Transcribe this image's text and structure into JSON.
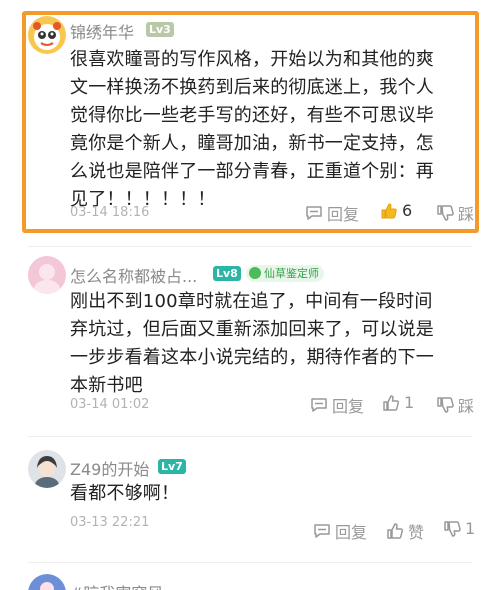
{
  "comments": [
    {
      "name": "锦绣年华",
      "level": "Lv3",
      "text_lines": [
        "很喜欢瞳哥的写作风格，开始以为和其他的爽",
        "文一样换汤不换药到后来的彻底迷上，我个人",
        "觉得你比一些老手写的还好，有些不可思议毕",
        "竟你是个新人，瞳哥加油，新书一定支持，怎",
        "么说也是陪伴了一部分青春，正重道个别：再",
        "见了！！！！！！"
      ],
      "time": "03-14 18:16",
      "reply_label": "回复",
      "like_count": "6",
      "dislike_label": "踩",
      "highlighted": true,
      "liked": true
    },
    {
      "name": "怎么名称都被占...",
      "level": "Lv8",
      "badge": "仙草鉴定师",
      "text_lines": [
        "刚出不到100章时就在追了，中间有一段时间",
        "弃坑过，但后面又重新添加回来了，可以说是",
        "一步步看着这本小说完结的，期待作者的下一",
        "本新书吧"
      ],
      "time": "03-14 01:02",
      "reply_label": "回复",
      "like_count": "1",
      "dislike_label": "踩"
    },
    {
      "name": "Z49的开始",
      "level": "Lv7",
      "text_lines": [
        "看都不够啊！"
      ],
      "time": "03-13 22:21",
      "reply_label": "回复",
      "like_label": "赞",
      "dislike_count": "1"
    },
    {
      "name": "#晾我害窗风"
    }
  ],
  "colors": {
    "highlight_border": "#f39a2b",
    "liked_thumb": "#f5b81f",
    "level_teal": "#2bb5a6",
    "level_olive": "#b9c9a7",
    "badge_green": "#36a04a"
  }
}
